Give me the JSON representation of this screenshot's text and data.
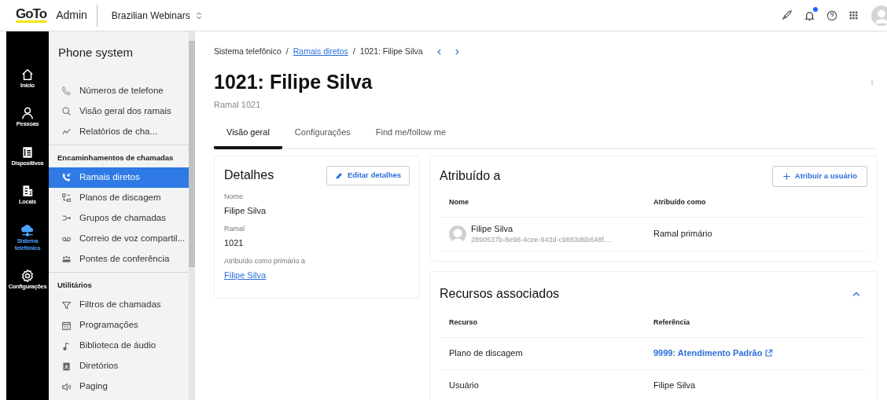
{
  "header": {
    "logo": "GoTo",
    "app": "Admin",
    "account": "Brazilian Webinars",
    "notifications_unread": true
  },
  "rail": [
    {
      "label": "Início",
      "selected": false
    },
    {
      "label": "Pessoas",
      "selected": false
    },
    {
      "label": "Dispositivos",
      "selected": false
    },
    {
      "label": "Locais",
      "selected": false
    },
    {
      "label": "Sistema telefônico",
      "selected": true
    },
    {
      "label": "Configurações",
      "selected": false
    }
  ],
  "sidebar": {
    "title": "Phone system",
    "groups": [
      {
        "items": [
          {
            "label": "Números de telefone",
            "selected": false
          },
          {
            "label": "Visão geral dos ramais",
            "selected": false
          },
          {
            "label": "Relatórios de cha...",
            "selected": false
          }
        ]
      },
      {
        "heading": "Encaminhamentos de chamadas",
        "items": [
          {
            "label": "Ramais diretos",
            "selected": true
          },
          {
            "label": "Planos de discagem",
            "selected": false
          },
          {
            "label": "Grupos de chamadas",
            "selected": false
          },
          {
            "label": "Correio de voz compartil...",
            "selected": false
          },
          {
            "label": "Pontes de conferência",
            "selected": false
          }
        ]
      },
      {
        "heading": "Utilitários",
        "items": [
          {
            "label": "Filtros de chamadas",
            "selected": false
          },
          {
            "label": "Programações",
            "selected": false
          },
          {
            "label": "Biblioteca de áudio",
            "selected": false
          },
          {
            "label": "Diretórios",
            "selected": false
          },
          {
            "label": "Paging",
            "selected": false
          }
        ]
      }
    ]
  },
  "breadcrumb": [
    {
      "label": "Sistema telefônico",
      "link": false
    },
    {
      "separator": "/",
      "label": "Ramais diretos",
      "link": true
    },
    {
      "separator": "/",
      "label": "1021: Filipe Silva",
      "link": false
    }
  ],
  "page": {
    "title": "1021: Filipe Silva",
    "subtitle": "Ramal 1021"
  },
  "tabs": [
    {
      "label": "Visão geral",
      "selected": true
    },
    {
      "label": "Configurações",
      "selected": false
    },
    {
      "label": "Find me/follow me",
      "selected": false
    }
  ],
  "details": {
    "title": "Detalhes",
    "button": "Editar detalhes",
    "fields": [
      {
        "label": "Nome",
        "value": "Filipe Silva",
        "link": false
      },
      {
        "label": "Ramal",
        "value": "1021",
        "link": false
      },
      {
        "label": "Atribuído como primário a",
        "value": "Filipe Silva",
        "link": true
      }
    ]
  },
  "assigned": {
    "title": "Atribuído a",
    "button": "Atribuir a usuário",
    "columns": [
      "Nome",
      "Atribuído como"
    ],
    "rows": [
      {
        "name": "Filipe Silva",
        "id": "2890537b-8e98-4cee-943d-c9883d6b648f....",
        "role": "Ramal primário"
      }
    ]
  },
  "resources": {
    "title": "Recursos associados",
    "expanded": true,
    "columns": [
      "Recurso",
      "Referência"
    ],
    "rows": [
      {
        "resource": "Plano de discagem",
        "reference": "9999: Atendimento Padrão",
        "link": true
      },
      {
        "resource": "Usuário",
        "reference": "Filipe Silva",
        "link": false
      }
    ]
  }
}
